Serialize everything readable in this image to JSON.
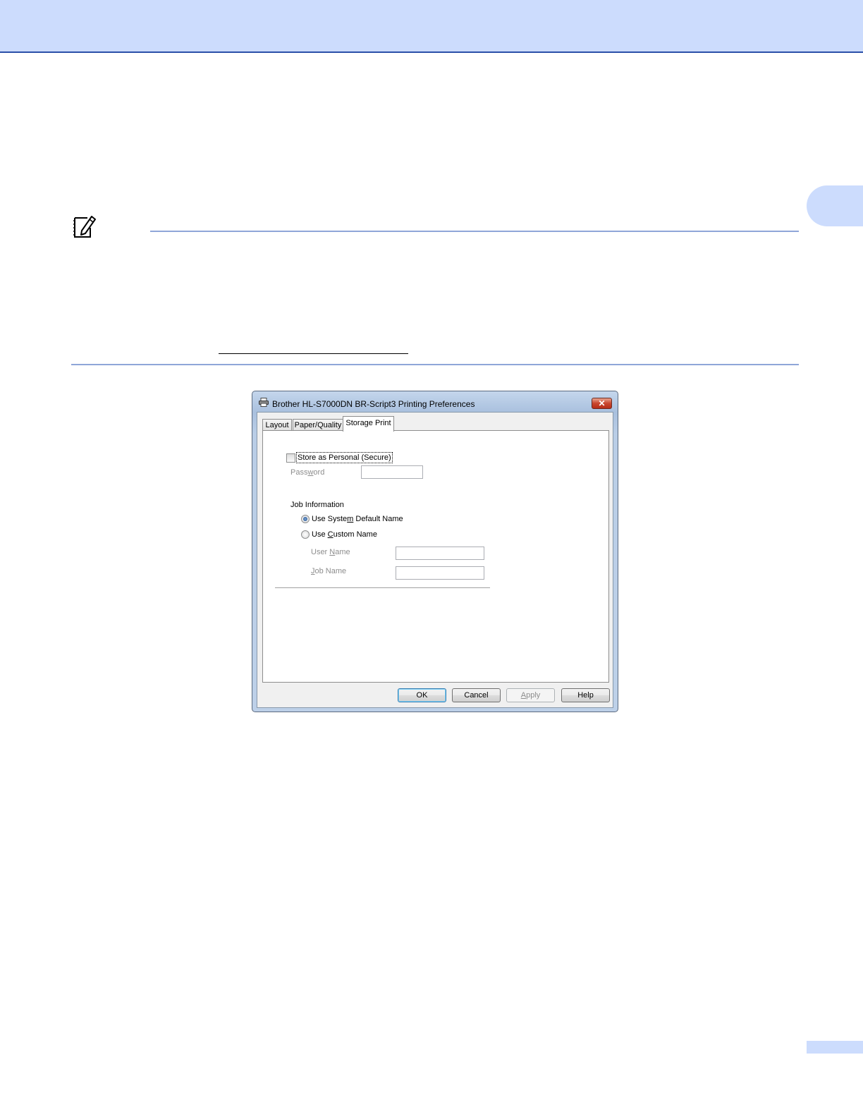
{
  "dialog": {
    "title": "Brother HL-S7000DN BR-Script3 Printing Preferences",
    "close_label": "✕",
    "tabs": [
      {
        "label": "Layout",
        "active": false
      },
      {
        "label": "Paper/Quality",
        "active": false
      },
      {
        "label": "Storage Print",
        "active": true
      }
    ],
    "store_secure": {
      "label": "Store as Personal (Secure)",
      "checked": false
    },
    "password": {
      "label_pre": "Pass",
      "label_accel": "w",
      "label_post": "ord",
      "value": ""
    },
    "job_info": {
      "heading": "Job Information",
      "options": [
        {
          "label_pre": "Use Syste",
          "label_accel": "m",
          "label_post": " Default Name",
          "selected": true
        },
        {
          "label_pre": "Use ",
          "label_accel": "C",
          "label_post": "ustom Name",
          "selected": false
        }
      ],
      "user_name": {
        "label_pre": "User ",
        "label_accel": "N",
        "label_post": "ame",
        "value": ""
      },
      "job_name": {
        "label_pre": "",
        "label_accel": "J",
        "label_post": "ob Name",
        "value": ""
      }
    },
    "buttons": {
      "ok": "OK",
      "cancel": "Cancel",
      "apply_accel": "A",
      "apply_post": "pply",
      "help": "Help"
    }
  },
  "colors": {
    "header_band": "#ccdcfd",
    "rule": "#8fa6d8"
  },
  "icons": [
    "note-pencil-icon",
    "printer-icon",
    "close-icon"
  ]
}
